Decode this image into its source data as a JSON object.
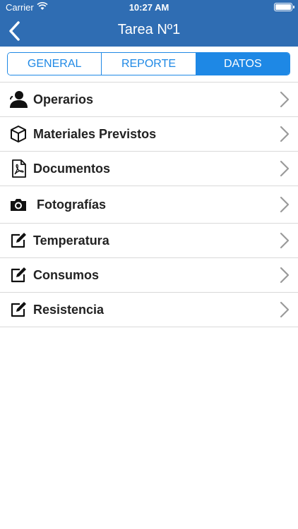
{
  "status": {
    "carrier": "Carrier",
    "time": "10:27 AM"
  },
  "nav": {
    "title": "Tarea Nº1"
  },
  "tabs": [
    {
      "label": "GENERAL",
      "active": false
    },
    {
      "label": "REPORTE",
      "active": false
    },
    {
      "label": "DATOS",
      "active": true
    }
  ],
  "items": [
    {
      "label": "Operarios",
      "icon": "user-icon"
    },
    {
      "label": "Materiales Previstos",
      "icon": "box-icon"
    },
    {
      "label": "Documentos",
      "icon": "pdf-icon"
    },
    {
      "label": "Fotografías",
      "icon": "camera-icon"
    },
    {
      "label": "Temperatura",
      "icon": "edit-icon"
    },
    {
      "label": "Consumos",
      "icon": "edit-icon"
    },
    {
      "label": "Resistencia",
      "icon": "edit-icon"
    }
  ],
  "colors": {
    "brand": "#2f6db3",
    "accent": "#1e88e5",
    "separator": "#d9d9d9"
  }
}
